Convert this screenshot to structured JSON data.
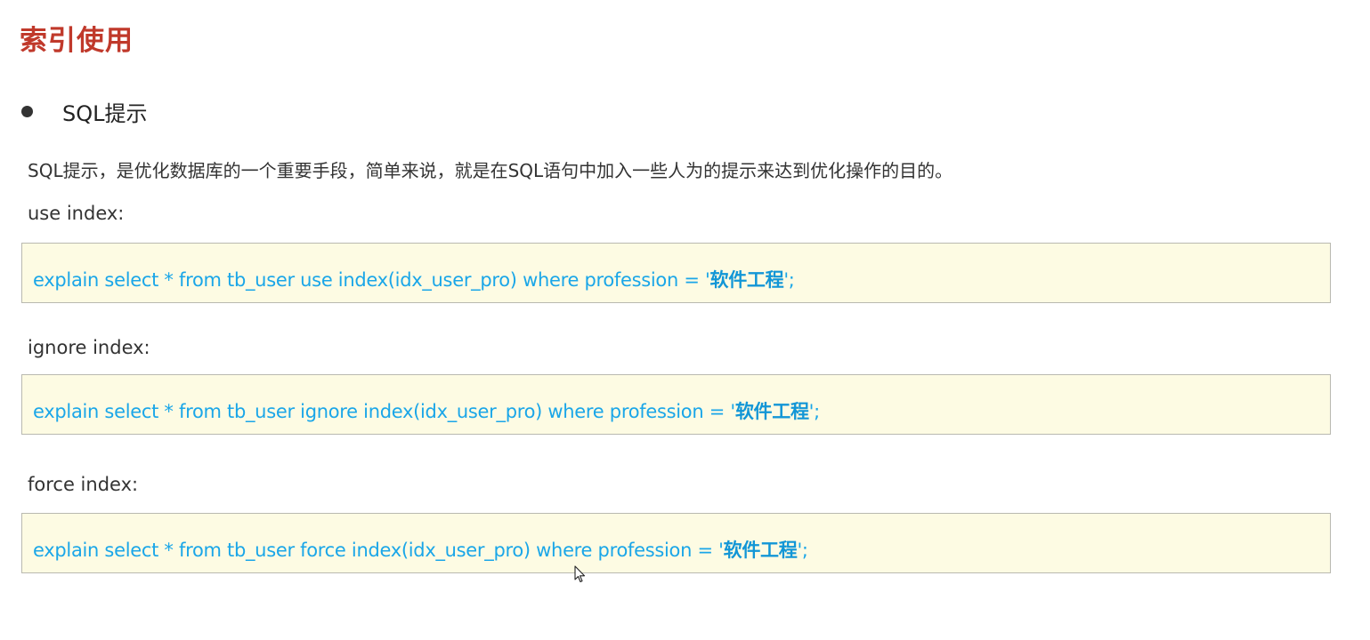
{
  "heading": "索引使用",
  "section": {
    "bullet": "SQL提示"
  },
  "description": "SQL提示，是优化数据库的一个重要手段，简单来说，就是在SQL语句中加入一些人为的提示来达到优化操作的目的。",
  "blocks": [
    {
      "label": "use index:",
      "code_prefix": "explain select * from tb_user use index(idx_user_pro) where profession = '",
      "code_literal": "软件工程",
      "code_suffix": "';"
    },
    {
      "label": "ignore index:",
      "code_prefix": "explain select * from tb_user ignore index(idx_user_pro) where profession = '",
      "code_literal": "软件工程",
      "code_suffix": "';"
    },
    {
      "label": "force index:",
      "code_prefix": "explain select * from tb_user force index(idx_user_pro) where profession = '",
      "code_literal": "软件工程",
      "code_suffix": "';"
    }
  ],
  "colors": {
    "heading": "#c0392b",
    "code": "#1aa6e8",
    "code_background": "#fdfbe3"
  },
  "icons": {
    "cursor": "mouse-pointer-icon"
  }
}
